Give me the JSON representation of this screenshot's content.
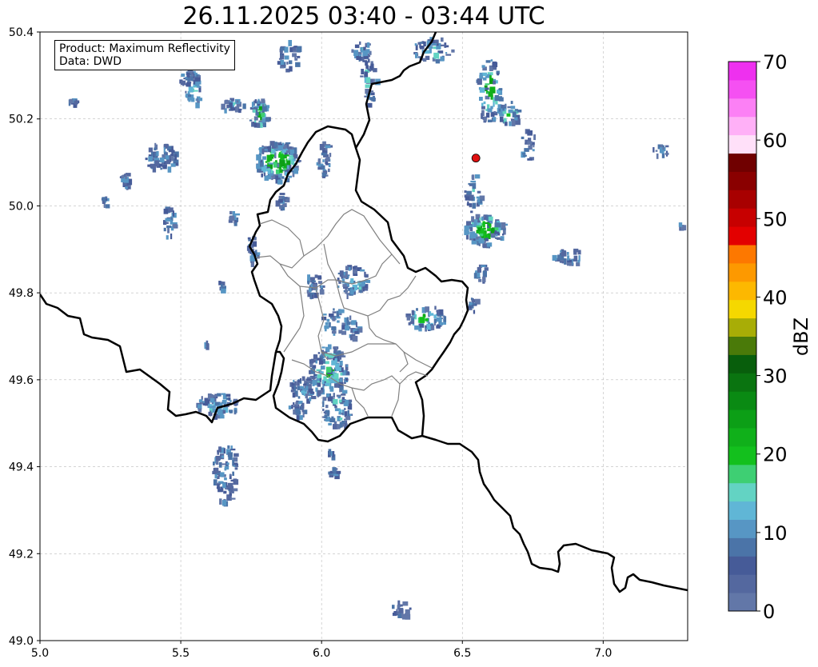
{
  "title": "26.11.2025 03:40 - 03:44 UTC",
  "info": {
    "product": "Product: Maximum Reflectivity",
    "data": "Data: DWD"
  },
  "axes": {
    "xlim": [
      5.0,
      7.3
    ],
    "ylim": [
      49.0,
      50.4
    ],
    "x_ticks": [
      "5.0",
      "5.5",
      "6.0",
      "6.5",
      "7.0"
    ],
    "y_ticks": [
      "49.0",
      "49.2",
      "49.4",
      "49.6",
      "49.8",
      "50.0",
      "50.2",
      "50.4"
    ],
    "grid": true
  },
  "colorbar": {
    "label": "dBZ",
    "min": 0,
    "max": 70,
    "ticks": [
      "0",
      "10",
      "20",
      "30",
      "40",
      "50",
      "60",
      "70"
    ],
    "colors": [
      "#6277a8",
      "#54689f",
      "#465b98",
      "#4b74a8",
      "#5796c4",
      "#60b6d6",
      "#63d3c3",
      "#3ecf73",
      "#13c01d",
      "#10b01a",
      "#0c9f16",
      "#0a8a13",
      "#0a7410",
      "#085e0c",
      "#4a7a09",
      "#a8ad06",
      "#f5d800",
      "#fdb800",
      "#fd9900",
      "#fd7800",
      "#e30000",
      "#c70000",
      "#a80000",
      "#8a0000",
      "#700000",
      "#ffe0f9",
      "#ffb0f7",
      "#fc80f5",
      "#f550f2",
      "#ee30ef"
    ]
  },
  "markers": [
    {
      "name": "radar-site",
      "lon": 6.548,
      "lat": 50.11,
      "color": "#e01010"
    }
  ],
  "colors": {
    "border_country": "#000000",
    "border_canton": "#808080",
    "grid": "#bbbbbb"
  }
}
